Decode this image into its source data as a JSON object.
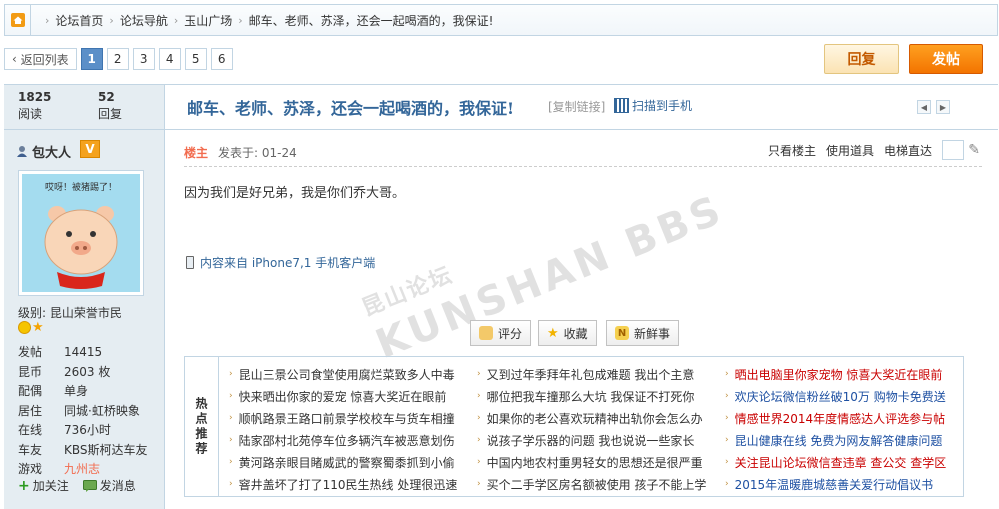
{
  "breadcrumb": {
    "items": [
      "论坛首页",
      "论坛导航",
      "玉山广场",
      "邮车、老师、苏泽，还会一起喝酒的，我保证!"
    ]
  },
  "pager": {
    "back": "返回列表",
    "pages": [
      "1",
      "2",
      "3",
      "4",
      "5",
      "6"
    ],
    "current_page": "1"
  },
  "buttons": {
    "reply": "回复",
    "post": "发帖"
  },
  "stats": {
    "reads": "1825",
    "reads_label": "阅读",
    "replies": "52",
    "replies_label": "回复"
  },
  "thread": {
    "title": "邮车、老师、苏泽，还会一起喝酒的，我保证!",
    "copy_link": "[复制链接]",
    "scan": "扫描到手机"
  },
  "author": {
    "name": "包大人",
    "badge": "V",
    "avatar_caption": "哎呀！被猪踢了！",
    "level": "级别: 昆山荣誉市民",
    "info": [
      {
        "k": "发帖",
        "v": "14415"
      },
      {
        "k": "昆币",
        "v": "2603 枚"
      },
      {
        "k": "配偶",
        "v": "单身"
      },
      {
        "k": "居住",
        "v": "同城·虹桥映象"
      },
      {
        "k": "在线",
        "v": "736小时"
      },
      {
        "k": "车友",
        "v": "KBS斯柯达车友"
      },
      {
        "k": "游戏",
        "v": "九州志"
      }
    ],
    "follow": "加关注",
    "message": "发消息"
  },
  "post": {
    "owner": "楼主",
    "time": "发表于: 01-24",
    "tools": [
      "只看楼主",
      "使用道具",
      "电梯直达"
    ],
    "body": "因为我们是好兄弟，我是你们乔大哥。",
    "source": "内容来自 iPhone7,1 手机客户端",
    "watermark_top": "昆山论坛",
    "watermark_main": "KUNSHAN BBS"
  },
  "rate_buttons": [
    "评分",
    "收藏",
    "新鲜事"
  ],
  "hot": {
    "label": "热点推荐",
    "col1": [
      "昆山三景公司食堂使用腐烂菜致多人中毒",
      "快来晒出你家的爱宠 惊喜大奖近在眼前",
      "顺帆路景王路口前景学校校车与货车相撞",
      "陆家邵村北苑停车位多辆汽车被恶意划伤",
      "黄河路亲眼目睹威武的警察蜀黍抓到小偷",
      "窨井盖坏了打了110民生热线 处理很迅速"
    ],
    "col2": [
      "又到过年季拜年礼包成难题 我出个主意",
      "哪位把我车撞那么大坑 我保证不打死你",
      "如果你的老公喜欢玩精神出轨你会怎么办",
      "说孩子学乐器的问题 我也说说一些家长",
      "中国内地农村重男轻女的思想还是很严重",
      "买个二手学区房名额被使用 孩子不能上学"
    ],
    "col3": [
      "晒出电脑里你家宠物 惊喜大奖近在眼前",
      "欢庆论坛微信粉丝破10万 购物卡免费送",
      "情感世界2014年度情感达人评选参与帖",
      "昆山健康在线 免费为网友解答健康问题",
      "关注昆山论坛微信查违章 查公交 查学区",
      "2015年温暖鹿城慈善关爱行动倡议书"
    ]
  },
  "colors": {
    "link": "#336699",
    "owner": "#f26c4f",
    "post_btn": "#f37400",
    "sidebar_bg": "#e5edf2",
    "border": "#c2d5e3"
  }
}
